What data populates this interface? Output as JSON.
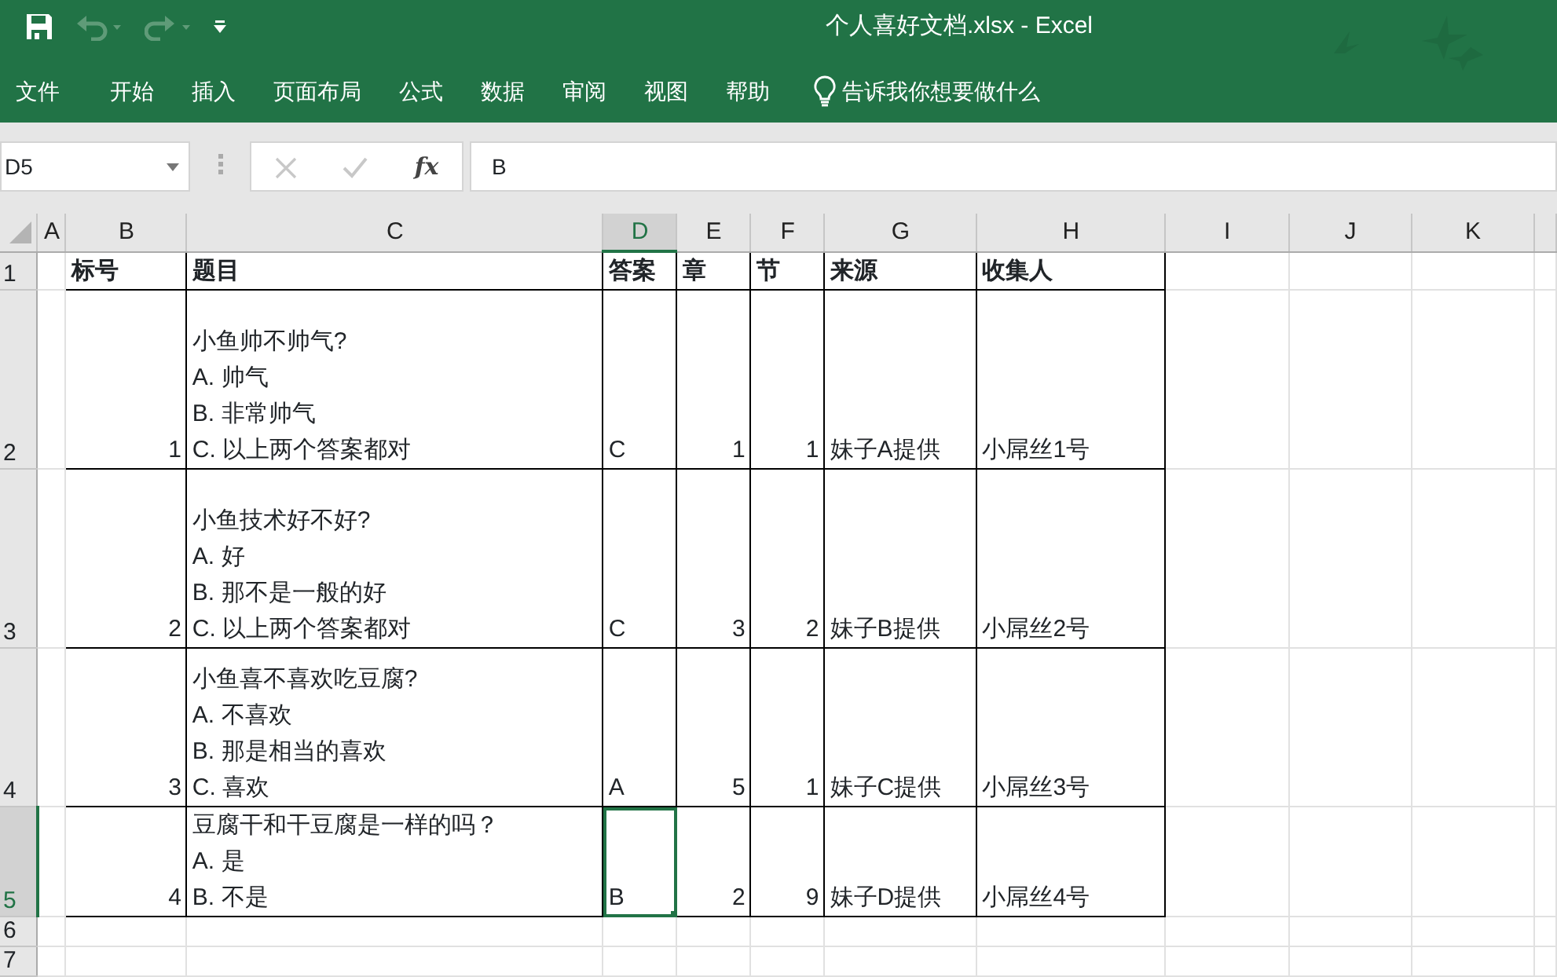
{
  "window": {
    "title": "个人喜好文档.xlsx  -  Excel"
  },
  "quick_access": [
    {
      "kind": "save"
    },
    {
      "kind": "undo",
      "disabled": true
    },
    {
      "kind": "redo",
      "disabled": true
    },
    {
      "kind": "customize"
    }
  ],
  "ribbon_tabs": [
    {
      "label": "文件",
      "selected": false
    },
    {
      "label": "开始",
      "selected": false
    },
    {
      "label": "插入",
      "selected": false
    },
    {
      "label": "页面布局",
      "selected": false
    },
    {
      "label": "公式",
      "selected": false
    },
    {
      "label": "数据",
      "selected": false
    },
    {
      "label": "审阅",
      "selected": false
    },
    {
      "label": "视图",
      "selected": false
    },
    {
      "label": "帮助",
      "selected": false
    }
  ],
  "tell_me": {
    "placeholder": "告诉我你想要做什么"
  },
  "formula_bar": {
    "name_box": "D5",
    "cancel_disabled": true,
    "enter_disabled": true,
    "function_label": "fx",
    "value": "B"
  },
  "column_headers": [
    {
      "label": "A",
      "selected": false
    },
    {
      "label": "B",
      "selected": false
    },
    {
      "label": "C",
      "selected": false
    },
    {
      "label": "D",
      "selected": true
    },
    {
      "label": "E",
      "selected": false
    },
    {
      "label": "F",
      "selected": false
    },
    {
      "label": "G",
      "selected": false
    },
    {
      "label": "H",
      "selected": false
    },
    {
      "label": "I",
      "selected": false
    },
    {
      "label": "J",
      "selected": false
    },
    {
      "label": "K",
      "selected": false
    }
  ],
  "rows": [
    {
      "header": "1",
      "selected": false,
      "cells": [
        {
          "kind": "header",
          "text": "标号"
        },
        {
          "kind": "header",
          "lines": [
            "题目"
          ]
        },
        {
          "kind": "header",
          "text": "答案"
        },
        {
          "kind": "header",
          "text": "章"
        },
        {
          "kind": "header",
          "text": "节"
        },
        {
          "kind": "header",
          "text": "来源"
        },
        {
          "kind": "header",
          "text": "收集人"
        }
      ]
    },
    {
      "header": "2",
      "selected": false,
      "cells": [
        {
          "kind": "number",
          "text": "1"
        },
        {
          "kind": "lines",
          "lines": [
            "小鱼帅不帅气?",
            "A. 帅气",
            "B. 非常帅气",
            "C. 以上两个答案都对"
          ]
        },
        {
          "kind": "text",
          "text": "C"
        },
        {
          "kind": "number",
          "text": "1"
        },
        {
          "kind": "number",
          "text": "1"
        },
        {
          "kind": "text",
          "text": "妹子A提供"
        },
        {
          "kind": "text",
          "text": "小屌丝1号"
        }
      ]
    },
    {
      "header": "3",
      "selected": false,
      "cells": [
        {
          "kind": "number",
          "text": "2"
        },
        {
          "kind": "lines",
          "lines": [
            "小鱼技术好不好?",
            "A. 好",
            "B. 那不是一般的好",
            "C. 以上两个答案都对"
          ]
        },
        {
          "kind": "text",
          "text": "C"
        },
        {
          "kind": "number",
          "text": "3"
        },
        {
          "kind": "number",
          "text": "2"
        },
        {
          "kind": "text",
          "text": "妹子B提供"
        },
        {
          "kind": "text",
          "text": "小屌丝2号"
        }
      ]
    },
    {
      "header": "4",
      "selected": false,
      "cells": [
        {
          "kind": "number",
          "text": "3"
        },
        {
          "kind": "lines",
          "lines": [
            "小鱼喜不喜欢吃豆腐?",
            "A. 不喜欢",
            "B. 那是相当的喜欢",
            "C. 喜欢"
          ]
        },
        {
          "kind": "text",
          "text": "A"
        },
        {
          "kind": "number",
          "text": "5"
        },
        {
          "kind": "number",
          "text": "1"
        },
        {
          "kind": "text",
          "text": "妹子C提供"
        },
        {
          "kind": "text",
          "text": "小屌丝3号"
        }
      ]
    },
    {
      "header": "5",
      "selected": true,
      "cells": [
        {
          "kind": "number",
          "text": "4"
        },
        {
          "kind": "lines",
          "lines": [
            "豆腐干和干豆腐是一样的吗？",
            "A. 是",
            "B. 不是"
          ]
        },
        {
          "kind": "text",
          "text": "B"
        },
        {
          "kind": "number",
          "text": "2"
        },
        {
          "kind": "number",
          "text": "9"
        },
        {
          "kind": "text",
          "text": "妹子D提供"
        },
        {
          "kind": "text",
          "text": "小屌丝4号"
        }
      ]
    },
    {
      "header": "6",
      "selected": false,
      "cells": []
    },
    {
      "header": "7",
      "selected": false,
      "cells": []
    }
  ]
}
